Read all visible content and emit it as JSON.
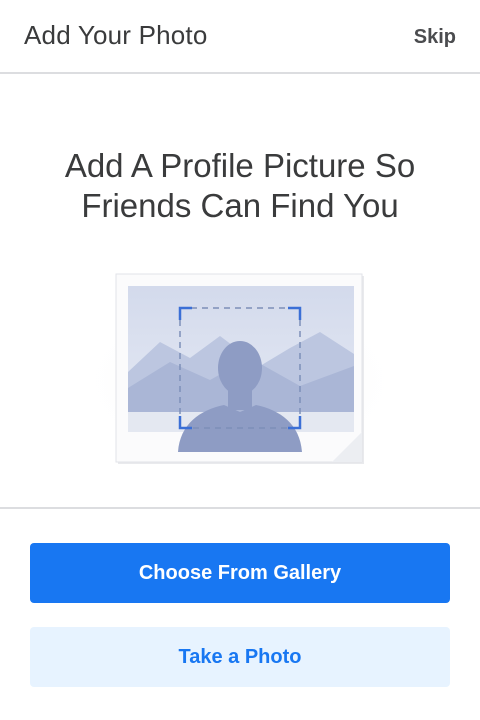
{
  "header": {
    "title": "Add Your Photo",
    "skip_label": "Skip"
  },
  "main": {
    "headline_line1": "Add A Profile Picture So",
    "headline_line2": "Friends Can Find You"
  },
  "actions": {
    "gallery_label": "Choose From Gallery",
    "camera_label": "Take a Photo"
  },
  "icons": {
    "illustration": "profile-photo-placeholder-icon"
  },
  "colors": {
    "primary": "#1877f2",
    "secondary_bg": "#e7f3ff",
    "text": "#3a3b3c",
    "silhouette": "#8e9cc4"
  }
}
